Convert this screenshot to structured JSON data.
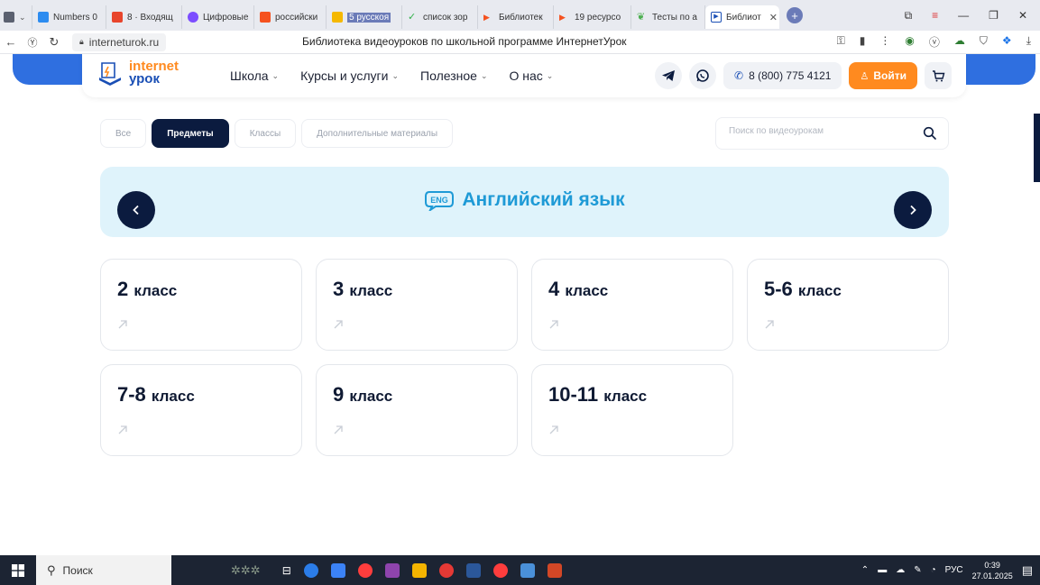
{
  "browser": {
    "tabs": [
      {
        "label": "",
        "color": "#5b6170"
      },
      {
        "label": "Numbers 0",
        "color": "#2d8cf0"
      },
      {
        "label": "8 · Входящ",
        "color": "#e8452c"
      },
      {
        "label": "Цифровые",
        "color": "#7c4dff"
      },
      {
        "label": "российски",
        "color": "#f5521f"
      },
      {
        "label": "5 русскоя",
        "color": "#f5b800"
      },
      {
        "label": "список зор",
        "color": "#33b24a"
      },
      {
        "label": "Библиотек",
        "color": "#f5521f"
      },
      {
        "label": "19 ресурсо",
        "color": "#f5521f"
      },
      {
        "label": "Тесты по а",
        "color": "#4caf50"
      },
      {
        "label": "Библиот",
        "color": "#1a4fb5"
      }
    ],
    "url": "interneturok.ru",
    "page_title": "Библиотека видеоуроков по школьной программе ИнтернетУрок"
  },
  "site": {
    "logo": {
      "line1": "internet",
      "line2": "урок"
    },
    "menu": [
      {
        "label": "Школа"
      },
      {
        "label": "Курсы и услуги"
      },
      {
        "label": "Полезное"
      },
      {
        "label": "О нас"
      }
    ],
    "phone": "8 (800) 775 4121",
    "login_label": "Войти"
  },
  "filters": {
    "chips": [
      {
        "label": "Все",
        "active": false
      },
      {
        "label": "Предметы",
        "active": true
      },
      {
        "label": "Классы",
        "active": false
      },
      {
        "label": "Дополнительные материалы",
        "active": false
      }
    ],
    "search_placeholder": "Поиск по видеоурокам"
  },
  "subject": {
    "title": "Английский язык",
    "badge": "ENG"
  },
  "grades": [
    {
      "num": "2",
      "suffix": "класс"
    },
    {
      "num": "3",
      "suffix": "класс"
    },
    {
      "num": "4",
      "suffix": "класс"
    },
    {
      "num": "5-6",
      "suffix": "класс"
    },
    {
      "num": "7-8",
      "suffix": "класс"
    },
    {
      "num": "9",
      "suffix": "класс"
    },
    {
      "num": "10-11",
      "suffix": "класс"
    }
  ],
  "taskbar": {
    "search_label": "Поиск",
    "lang": "РУС",
    "time": "0:39",
    "date": "27.01.2025"
  },
  "colors": {
    "accent_orange": "#ff8a1f",
    "brand_blue": "#1a4fb5",
    "navy": "#0b1b3f",
    "subject_blue": "#1e9ad6",
    "banner_bg": "#dff3fb"
  }
}
